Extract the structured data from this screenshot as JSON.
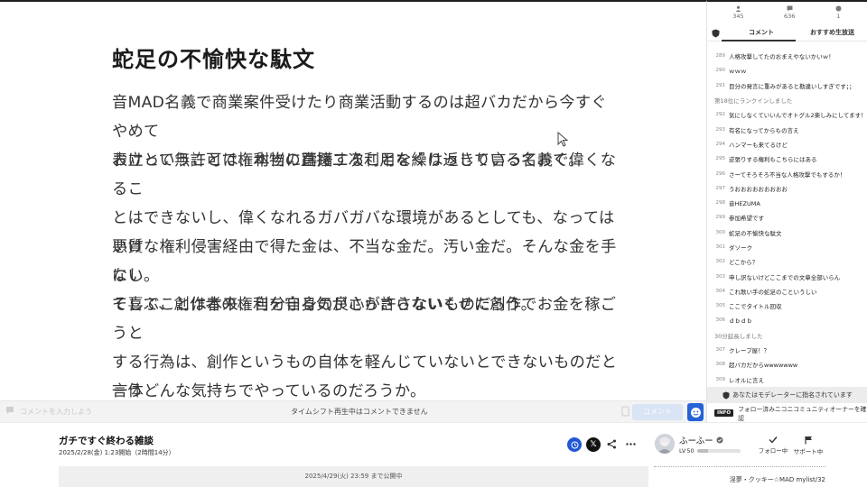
{
  "slide": {
    "title": "蛇足の不愉快な駄文",
    "paragraphs": [
      "音MAD名義で商業案件受けたり商業活動するのは超バカだから今すぐやめて\nおけということは、本当に躊躇することなくはっきり言っておく。",
      "表立って無許可で権利物の直接二次利用を繰り返している名義で偉くなるこ\nとはできないし、偉くなれるガバガバな環境があるとしても、なってはいけ\nない。",
      "悪質な権利侵害経由で得た金は、不当な金だ。汚い金だ。そんな金を手にし\nて喜ぶことは本来、自分自身の良心が許さないものだろう。",
      "そして、創作者の権利を守る気がさらさらないくせに創作でお金を稼ごうと\nする行為は、創作というもの自体を軽んじていないとできないものだと言う\nほかない。",
      "一体どんな気持ちでやっているのだろうか。"
    ]
  },
  "comment_bar": {
    "placeholder": "コメントを入力しよう",
    "timeshift_notice": "タイムシフト再生中はコメントできません",
    "comment_button": "コメント"
  },
  "stats": [
    {
      "icon": "viewer-icon",
      "value": "345"
    },
    {
      "icon": "comment-count-icon",
      "value": "636"
    },
    {
      "icon": "ad-icon",
      "value": "1"
    }
  ],
  "tabs": {
    "comment": "コメント",
    "recommend": "おすすめ生放送"
  },
  "comments": [
    {
      "no": "289",
      "text": "人格攻撃してたのおまえやないかいｗ！"
    },
    {
      "no": "290",
      "text": "ｗｗｗ"
    },
    {
      "no": "291",
      "text": "目分の発言に重みがあると勘違いしすぎです；；"
    },
    {
      "no": "",
      "text": "第18位にランクインしました",
      "system": true
    },
    {
      "no": "292",
      "text": "気にしなくていいんでオトグル2楽しみにしてます！"
    },
    {
      "no": "293",
      "text": "有名になってからもの言え"
    },
    {
      "no": "294",
      "text": "ハンマーも来てるけど"
    },
    {
      "no": "295",
      "text": "逆張りする権利もこちらにはある"
    },
    {
      "no": "296",
      "text": "さーてそろそろ不当な人格攻撃でもするか！"
    },
    {
      "no": "297",
      "text": "うおおおおおおおおお"
    },
    {
      "no": "298",
      "text": "音HEZUMA"
    },
    {
      "no": "299",
      "text": "参加希望です"
    },
    {
      "no": "300",
      "text": "蛇足の不愉快な駄文"
    },
    {
      "no": "301",
      "text": "ダソーク"
    },
    {
      "no": "302",
      "text": "どこから？"
    },
    {
      "no": "303",
      "text": "申し訳ないけどここまでの文章全部いらん"
    },
    {
      "no": "304",
      "text": "これ歌い手の蛇足のこというしい"
    },
    {
      "no": "305",
      "text": "ここでタイトル回収"
    },
    {
      "no": "306",
      "text": "ｄｂｄｂ"
    },
    {
      "no": "",
      "text": "30分延長しました",
      "system": true
    },
    {
      "no": "307",
      "text": "クレープ屋！？"
    },
    {
      "no": "308",
      "text": "超バカだからwwwwwww"
    },
    {
      "no": "309",
      "text": "レオルに言え"
    }
  ],
  "moderator_notice": "あなたはモデレーターに指名されています",
  "info_bar": {
    "badge": "INFO",
    "text": "フォロー済みニコニコミュニティオーナーを確認"
  },
  "program": {
    "title": "ガチですぐ終わる雑談",
    "date": "2025/2/28(金) 1:23開始（2時間14分）",
    "public_until": "2025/4/29(火) 23:59 まで公開中"
  },
  "owner": {
    "name": "ふーふー",
    "level_label": "LV",
    "level": "50",
    "level_progress": 0.25,
    "follow_label": "フォロー中",
    "support_label": "サポート中"
  },
  "related": {
    "text": "淫夢・クッキー☆MAD mylist/32"
  },
  "colors": {
    "accent_blue": "#2563d6",
    "share_blue": "#1f57d6"
  }
}
